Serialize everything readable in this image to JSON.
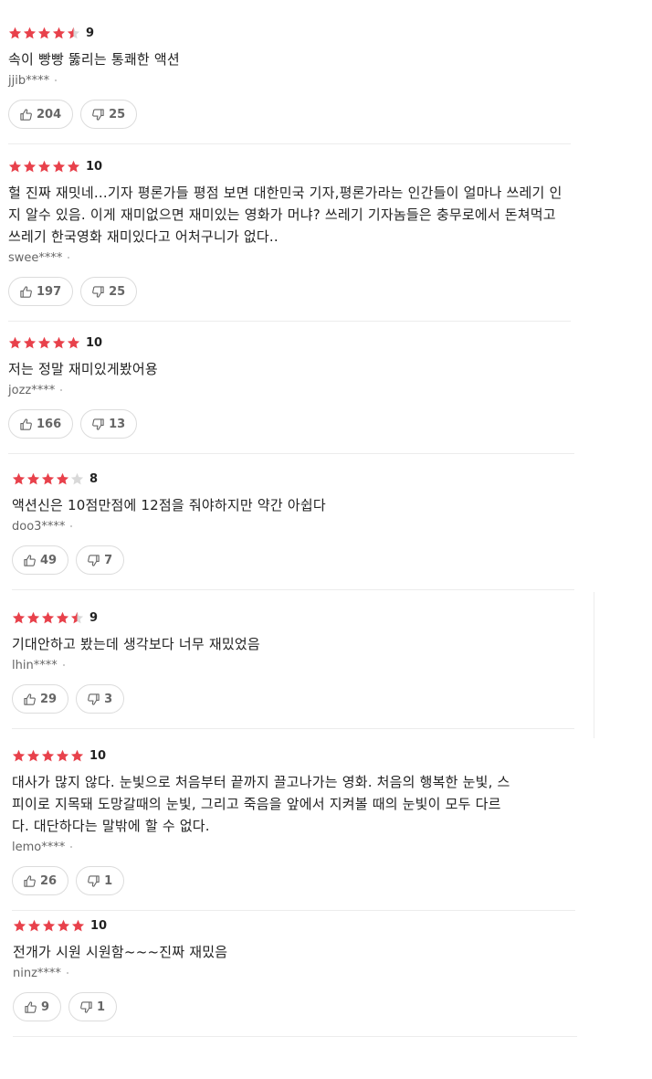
{
  "colors": {
    "star_filled": "#e8414b",
    "star_empty": "#d9d9d9"
  },
  "reviews": [
    {
      "stars": 4.5,
      "score": "9",
      "text": "속이 빵빵 뚫리는 통쾌한 액션",
      "author": "jjib****",
      "likes": "204",
      "dislikes": "25"
    },
    {
      "stars": 5,
      "score": "10",
      "text": "헐 진짜 재밋네...기자 평론가들 평점 보면 대한민국 기자,평론가라는 인간들이 얼마나 쓰레기 인지 알수 있음. 이게 재미없으면 재미있는 영화가 머냐? 쓰레기 기자놈들은 충무로에서 돈쳐먹고 쓰레기 한국영화 재미있다고 어처구니가 없다..",
      "author": "swee****",
      "likes": "197",
      "dislikes": "25"
    },
    {
      "stars": 5,
      "score": "10",
      "text": "저는 정말 재미있게봤어용",
      "author": "jozz****",
      "likes": "166",
      "dislikes": "13"
    },
    {
      "stars": 4,
      "score": "8",
      "text": "액션신은 10점만점에 12점을 줘야하지만 약간 아쉽다",
      "author": "doo3****",
      "likes": "49",
      "dislikes": "7"
    },
    {
      "stars": 4.5,
      "score": "9",
      "text": "기대안하고 봤는데 생각보다 너무 재밌었음",
      "author": "lhin****",
      "likes": "29",
      "dislikes": "3"
    },
    {
      "stars": 5,
      "score": "10",
      "text": "대사가 많지 않다. 눈빛으로 처음부터 끝까지 끌고나가는 영화. 처음의 행복한 눈빛, 스피이로 지목돼 도망갈때의 눈빛, 그리고 죽음을 앞에서 지켜볼 때의 눈빛이 모두 다르다. 대단하다는 말밖에 할 수 없다.",
      "author": "lemo****",
      "likes": "26",
      "dislikes": "1"
    },
    {
      "stars": 5,
      "score": "10",
      "text": "전개가 시원 시원함~~~진짜 재밌음",
      "author": "ninz****",
      "likes": "9",
      "dislikes": "1"
    }
  ]
}
